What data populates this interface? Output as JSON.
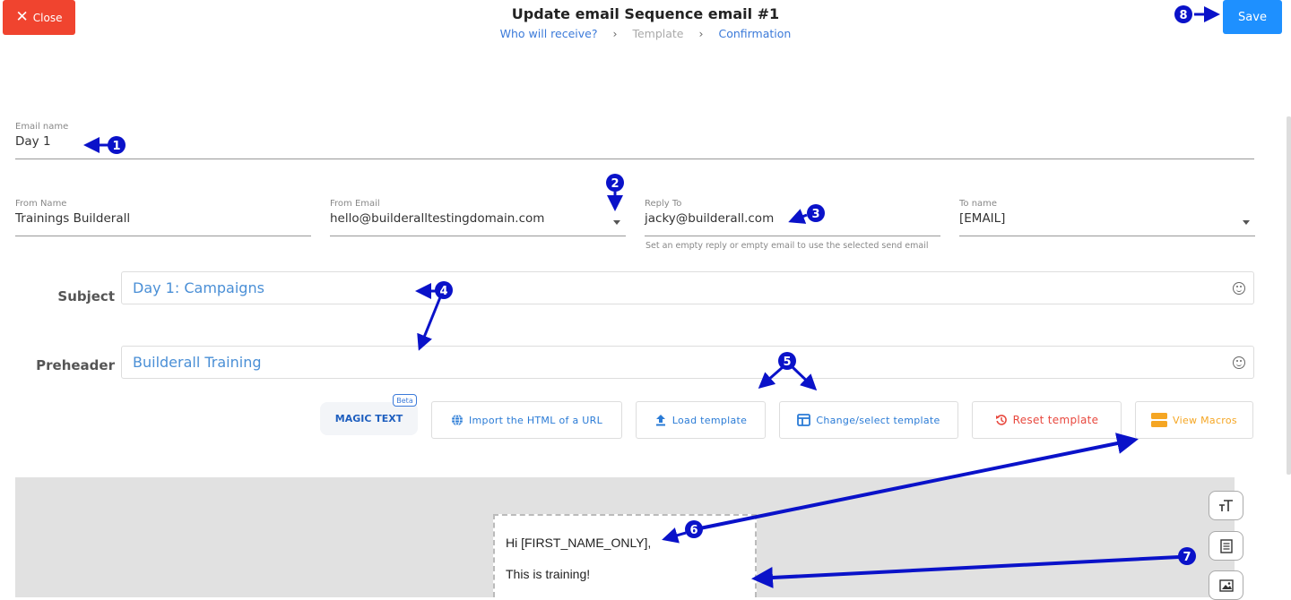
{
  "header": {
    "close_label": "Close",
    "title": "Update email Sequence email #1",
    "steps": [
      "Who will receive?",
      "Template",
      "Confirmation"
    ],
    "save_label": "Save"
  },
  "form": {
    "email_name": {
      "label": "Email name",
      "value": "Day 1"
    },
    "from_name": {
      "label": "From Name",
      "value": "Trainings Builderall"
    },
    "from_email": {
      "label": "From Email",
      "value": "hello@builderalltestingdomain.com"
    },
    "reply_to": {
      "label": "Reply To",
      "value": "jacky@builderall.com",
      "hint": "Set an empty reply or empty email to use the selected send email"
    },
    "to_name": {
      "label": "To name",
      "value": "[EMAIL]"
    },
    "subject": {
      "label": "Subject",
      "value": "Day 1: Campaigns"
    },
    "preheader": {
      "label": "Preheader",
      "value": "Builderall Training"
    }
  },
  "toolbar": {
    "magic_text": "MAGIC TEXT",
    "beta": "Beta",
    "import_html": "Import the HTML of a URL",
    "load_template": "Load template",
    "change_template": "Change/select template",
    "reset_template": "Reset template",
    "view_macros": "View Macros"
  },
  "email_preview": {
    "greeting": "Hi [FIRST_NAME_ONLY],",
    "body": "This is training!"
  },
  "annotations": [
    "1",
    "2",
    "3",
    "4",
    "5",
    "6",
    "7",
    "8"
  ],
  "colors": {
    "close": "#f0442f",
    "save": "#1e90ff",
    "link": "#3b7ad9",
    "annotation": "#0a12c9"
  }
}
